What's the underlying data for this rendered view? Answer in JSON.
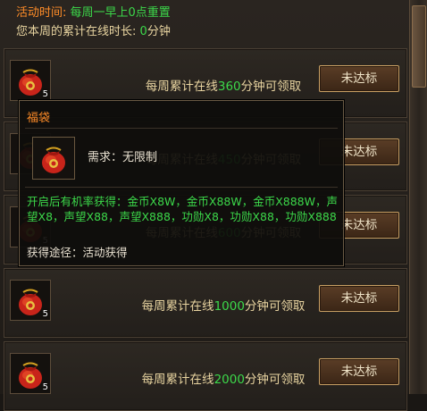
{
  "header": {
    "activity_time_label": "活动时间:",
    "activity_time_value": "每周一早上0点重置",
    "weekly_online_label": "您本周的累计在线时长:",
    "weekly_online_value": "0",
    "weekly_online_unit": "分钟"
  },
  "rows": [
    {
      "prefix": "每周累计在线",
      "minutes": "360",
      "suffix": "分钟可领取",
      "button": "未达标",
      "count": "5"
    },
    {
      "prefix": "每周累计在线",
      "minutes": "450",
      "suffix": "分钟可领取",
      "button": "未达标",
      "count": "5"
    },
    {
      "prefix": "每周累计在线",
      "minutes": "600",
      "suffix": "分钟可领取",
      "button": "未达标",
      "count": "5"
    },
    {
      "prefix": "每周累计在线",
      "minutes": "1000",
      "suffix": "分钟可领取",
      "button": "未达标",
      "count": "5"
    },
    {
      "prefix": "每周累计在线",
      "minutes": "2000",
      "suffix": "分钟可领取",
      "button": "未达标",
      "count": "5"
    }
  ],
  "tooltip": {
    "title": "福袋",
    "requirement": "需求：无限制",
    "open_chance": "开启后有机率获得：金币X8W，金币X88W，金币X888W，声望X8，声望X88，声望X888，功勋X8，功勋X88，功勋X888",
    "source": "获得途径：活动获得"
  },
  "colors": {
    "orange": "#ff8c28",
    "green": "#3cd84a",
    "button_border": "#c9a064",
    "bag_red": "#c8241a"
  },
  "icons": {
    "reward_item": "lucky-bag-icon"
  }
}
